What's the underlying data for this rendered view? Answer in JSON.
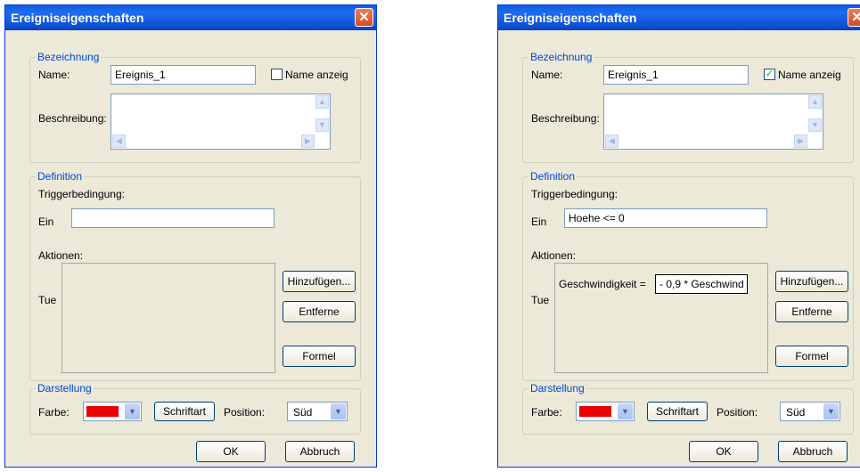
{
  "dialogs": [
    {
      "title": "Ereigniseigenschaften",
      "close_icon": "close-icon",
      "bezeichnung": {
        "legend": "Bezeichnung",
        "name_label": "Name:",
        "name_value": "Ereignis_1",
        "show_name_checked": false,
        "show_name_label": "Name anzeig",
        "description_label": "Beschreibung:"
      },
      "definition": {
        "legend": "Definition",
        "trigger_label": "Triggerbedingung:",
        "ein_label": "Ein",
        "trigger_value": "",
        "actions_label": "Aktionen:",
        "tue_label": "Tue",
        "action_name": "",
        "action_value": "",
        "add_label": "Hinzufügen...",
        "remove_label": "Entferne",
        "formula_label": "Formel"
      },
      "darstellung": {
        "legend": "Darstellung",
        "color_label": "Farbe:",
        "color": "#ee0000",
        "font_label": "Schriftart",
        "position_label": "Position:",
        "position_value": "Süd"
      },
      "ok_label": "OK",
      "cancel_label": "Abbruch"
    },
    {
      "title": "Ereigniseigenschaften",
      "close_icon": "close-icon",
      "bezeichnung": {
        "legend": "Bezeichnung",
        "name_label": "Name:",
        "name_value": "Ereignis_1",
        "show_name_checked": true,
        "show_name_label": "Name anzeig",
        "description_label": "Beschreibung:"
      },
      "definition": {
        "legend": "Definition",
        "trigger_label": "Triggerbedingung:",
        "ein_label": "Ein",
        "trigger_value": "Hoehe <= 0",
        "actions_label": "Aktionen:",
        "tue_label": "Tue",
        "action_name": "Geschwindigkeit =",
        "action_value": "- 0,9 * Geschwind",
        "add_label": "Hinzufügen...",
        "remove_label": "Entferne",
        "formula_label": "Formel"
      },
      "darstellung": {
        "legend": "Darstellung",
        "color_label": "Farbe:",
        "color": "#ee0000",
        "font_label": "Schriftart",
        "position_label": "Position:",
        "position_value": "Süd"
      },
      "ok_label": "OK",
      "cancel_label": "Abbruch"
    }
  ]
}
